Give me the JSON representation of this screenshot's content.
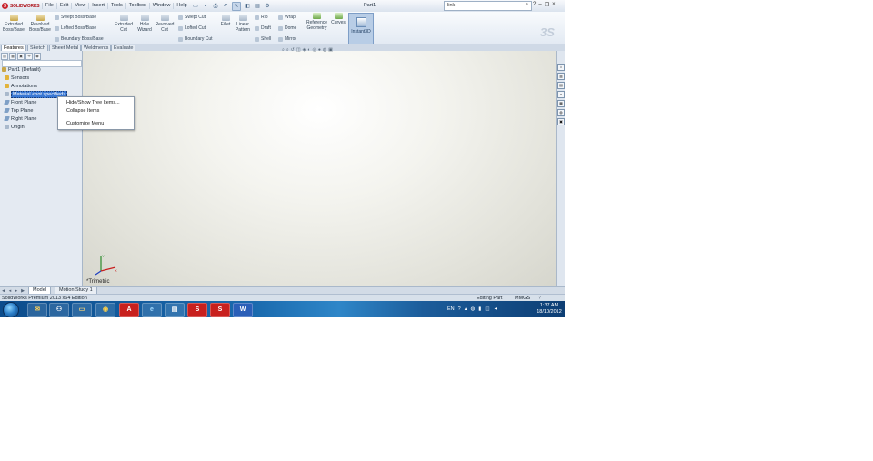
{
  "window": {
    "brand": "SOLIDWORKS",
    "document_title": "Part1",
    "menus": [
      "File",
      "Edit",
      "View",
      "Insert",
      "Tools",
      "Toolbox",
      "Window",
      "Help"
    ],
    "search_value": "link",
    "search_placeholder": "Search"
  },
  "ribbon": {
    "extruded_boss": "Extruded\nBoss/Base",
    "revolved_boss": "Revolved\nBoss/Base",
    "swept_boss": "Swept Boss/Base",
    "lofted_boss": "Lofted Boss/Base",
    "boundary_boss": "Boundary Boss/Base",
    "extruded_cut": "Extruded\nCut",
    "hole_wizard": "Hole\nWizard",
    "revolved_cut": "Revolved\nCut",
    "swept_cut": "Swept Cut",
    "lofted_cut": "Lofted Cut",
    "boundary_cut": "Boundary Cut",
    "fillet": "Fillet",
    "linear_pattern": "Linear\nPattern",
    "rib": "Rib",
    "draft": "Draft",
    "shell": "Shell",
    "wrap": "Wrap",
    "dome": "Dome",
    "mirror": "Mirror",
    "reference_geometry": "Reference\nGeometry",
    "curves": "Curves",
    "instant3d": "Instant3D"
  },
  "panel_tabs": [
    "Features",
    "Sketch",
    "Sheet Metal",
    "Weldments",
    "Evaluate"
  ],
  "tree": [
    {
      "label": "Part1 (Default)",
      "icon": "part-icon"
    },
    {
      "label": "Sensors",
      "icon": "sensors-icon"
    },
    {
      "label": "Annotations",
      "icon": "annotations-icon"
    },
    {
      "label": "Material <not specified>",
      "icon": "material-icon",
      "selected": true
    },
    {
      "label": "Front Plane",
      "icon": "plane-icon"
    },
    {
      "label": "Top Plane",
      "icon": "plane-icon"
    },
    {
      "label": "Right Plane",
      "icon": "plane-icon"
    },
    {
      "label": "Origin",
      "icon": "origin-icon"
    }
  ],
  "context_menu": {
    "items": [
      "Hide/Show Tree Items...",
      "Collapse Items",
      "Customize Menu"
    ]
  },
  "viewport": {
    "view_name": "*Trimetric"
  },
  "bottom_tabs": [
    "Model",
    "Motion Study 1"
  ],
  "status": {
    "left": "SolidWorks Premium 2013 x64 Edition",
    "mode": "Editing Part",
    "units": "MMGS"
  },
  "taskbar": {
    "lang": "EN",
    "time": "1:37 AM",
    "date": "18/10/2012"
  }
}
